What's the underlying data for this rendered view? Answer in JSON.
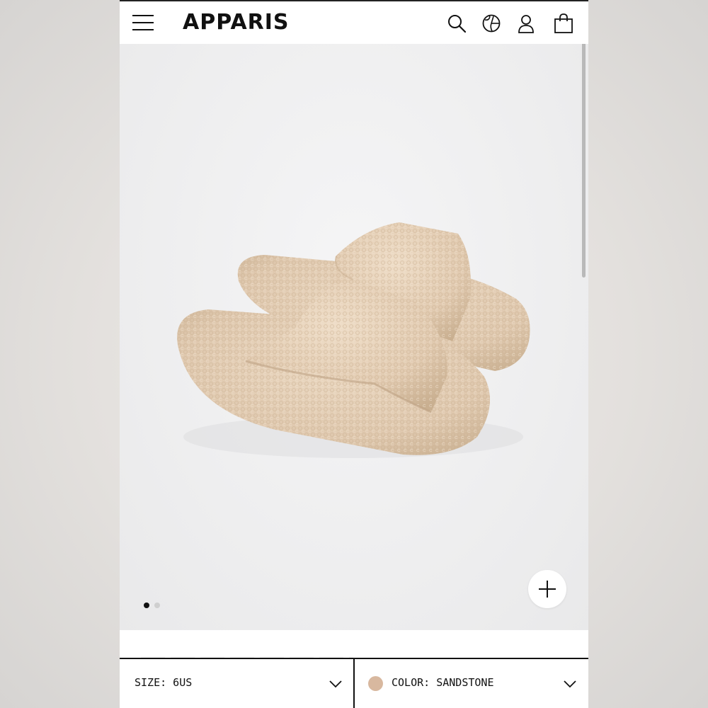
{
  "header": {
    "logo_text": "APPARIS",
    "icons": [
      "menu-icon",
      "search-icon",
      "globe-icon",
      "account-icon",
      "bag-icon"
    ]
  },
  "gallery": {
    "slide_count": 2,
    "active_slide": 1,
    "zoom_icon": "plus-icon",
    "product_color_hex": "#e2cdb5"
  },
  "selectors": {
    "size_label": "SIZE: 6US",
    "color_label": "COLOR: SANDSTONE",
    "color_swatch_hex": "#d8b89f",
    "chevron_icon": "chevron-down-icon"
  }
}
